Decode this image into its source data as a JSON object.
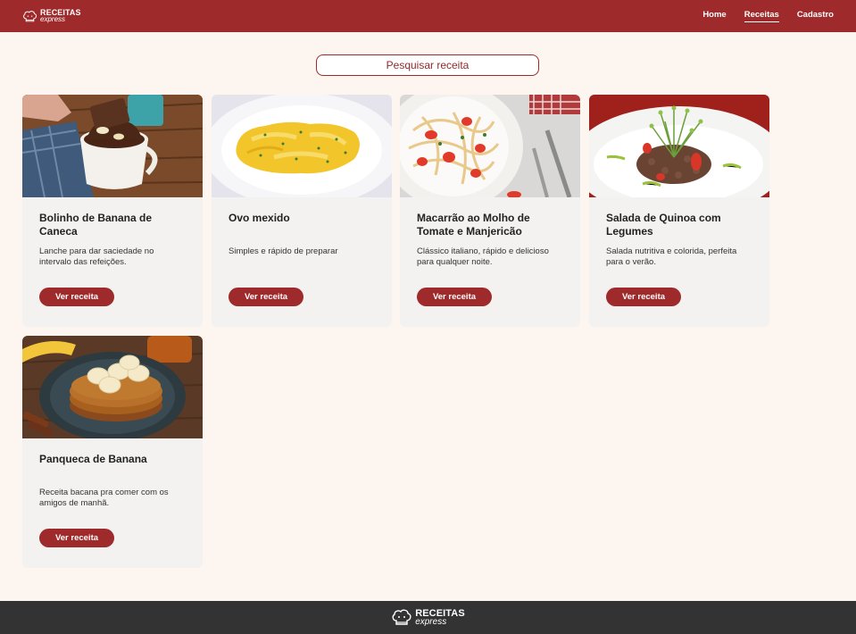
{
  "header": {
    "logo_top": "RECEITAS",
    "logo_bottom": "express",
    "nav": [
      {
        "label": "Home"
      },
      {
        "label": "Receitas"
      },
      {
        "label": "Cadastro"
      }
    ]
  },
  "search": {
    "placeholder": "Pesquisar receita"
  },
  "cards": [
    {
      "title": "Bolinho de Banana de Caneca",
      "description": "Lanche para dar saciedade no intervalo das refeições.",
      "button": "Ver receita",
      "image": "banana-mug-cake-image"
    },
    {
      "title": "Ovo mexido",
      "description": "Simples e rápido de preparar",
      "button": "Ver receita",
      "image": "scrambled-eggs-image"
    },
    {
      "title": "Macarrão ao Molho de Tomate e Manjericão",
      "description": "Clássico italiano, rápido e delicioso para qualquer noite.",
      "button": "Ver receita",
      "image": "tomato-pasta-image"
    },
    {
      "title": "Salada de Quinoa com Legumes",
      "description": "Salada nutritiva e colorida, perfeita para o verão.",
      "button": "Ver receita",
      "image": "quinoa-salad-image"
    },
    {
      "title": "Panqueca de Banana",
      "description": "Receita bacana pra comer com os amigos de manhã.",
      "button": "Ver receita",
      "image": "banana-pancake-image"
    }
  ],
  "footer": {
    "logo_top": "RECEITAS",
    "logo_bottom": "express"
  },
  "colors": {
    "brand": "#9e2a2b",
    "background": "#fdf5f0",
    "card": "#f3f2f0",
    "footer": "#333333"
  }
}
